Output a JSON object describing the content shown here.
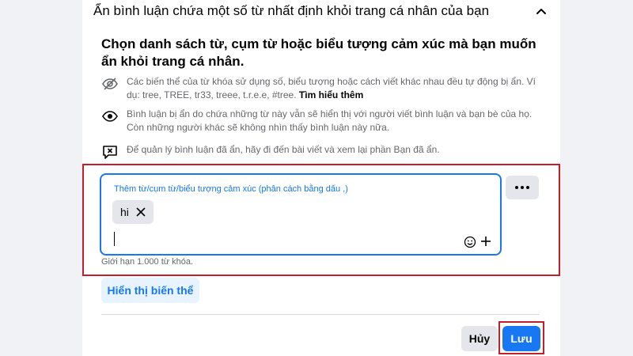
{
  "header": {
    "title": "Ẩn bình luận chứa một số từ nhất định khỏi trang cá nhân của bạn"
  },
  "main": {
    "heading": "Chọn danh sách từ, cụm từ hoặc biểu tượng cảm xúc mà bạn muốn ẩn khỏi trang cá nhân.",
    "info": [
      {
        "icon": "eye-slash-icon",
        "text": "Các biến thể của từ khóa sử dụng số, biểu tượng hoặc cách viết khác nhau đều tự động bị ẩn. Ví dụ: tree, TREE, tr33, treee, t.r.e.e, #tree.",
        "link": "Tìm hiểu thêm"
      },
      {
        "icon": "eye-icon",
        "text": "Bình luận bị ẩn do chứa những từ này vẫn sẽ hiển thị với người viết bình luận và bạn bè của họ. Còn những người khác sẽ không nhìn thấy bình luận này nữa."
      },
      {
        "icon": "comment-x-icon",
        "text": "Để quản lý bình luận đã ẩn, hãy đi đến bài viết và xem lại phần Bạn đã ẩn."
      }
    ],
    "keyword_input": {
      "label": "Thêm từ/cụm từ/biểu tượng cảm xúc (phân cách bằng dấu ,)",
      "chips": [
        "hi"
      ],
      "value": ""
    },
    "limit_text": "Giới hạn 1.000 từ khóa.",
    "variant_button": "Hiển thị biến thể"
  },
  "footer": {
    "cancel_label": "Hủy",
    "save_label": "Lưu"
  },
  "colors": {
    "accent": "#1877f2",
    "highlight": "#c41e2c"
  }
}
